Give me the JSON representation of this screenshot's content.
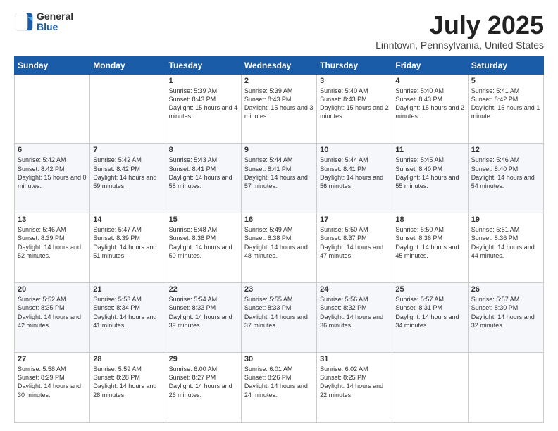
{
  "header": {
    "logo_general": "General",
    "logo_blue": "Blue",
    "month_title": "July 2025",
    "location": "Linntown, Pennsylvania, United States"
  },
  "days_of_week": [
    "Sunday",
    "Monday",
    "Tuesday",
    "Wednesday",
    "Thursday",
    "Friday",
    "Saturday"
  ],
  "weeks": [
    [
      {
        "day": "",
        "sunrise": "",
        "sunset": "",
        "daylight": ""
      },
      {
        "day": "",
        "sunrise": "",
        "sunset": "",
        "daylight": ""
      },
      {
        "day": "1",
        "sunrise": "Sunrise: 5:39 AM",
        "sunset": "Sunset: 8:43 PM",
        "daylight": "Daylight: 15 hours and 4 minutes."
      },
      {
        "day": "2",
        "sunrise": "Sunrise: 5:39 AM",
        "sunset": "Sunset: 8:43 PM",
        "daylight": "Daylight: 15 hours and 3 minutes."
      },
      {
        "day": "3",
        "sunrise": "Sunrise: 5:40 AM",
        "sunset": "Sunset: 8:43 PM",
        "daylight": "Daylight: 15 hours and 2 minutes."
      },
      {
        "day": "4",
        "sunrise": "Sunrise: 5:40 AM",
        "sunset": "Sunset: 8:43 PM",
        "daylight": "Daylight: 15 hours and 2 minutes."
      },
      {
        "day": "5",
        "sunrise": "Sunrise: 5:41 AM",
        "sunset": "Sunset: 8:42 PM",
        "daylight": "Daylight: 15 hours and 1 minute."
      }
    ],
    [
      {
        "day": "6",
        "sunrise": "Sunrise: 5:42 AM",
        "sunset": "Sunset: 8:42 PM",
        "daylight": "Daylight: 15 hours and 0 minutes."
      },
      {
        "day": "7",
        "sunrise": "Sunrise: 5:42 AM",
        "sunset": "Sunset: 8:42 PM",
        "daylight": "Daylight: 14 hours and 59 minutes."
      },
      {
        "day": "8",
        "sunrise": "Sunrise: 5:43 AM",
        "sunset": "Sunset: 8:41 PM",
        "daylight": "Daylight: 14 hours and 58 minutes."
      },
      {
        "day": "9",
        "sunrise": "Sunrise: 5:44 AM",
        "sunset": "Sunset: 8:41 PM",
        "daylight": "Daylight: 14 hours and 57 minutes."
      },
      {
        "day": "10",
        "sunrise": "Sunrise: 5:44 AM",
        "sunset": "Sunset: 8:41 PM",
        "daylight": "Daylight: 14 hours and 56 minutes."
      },
      {
        "day": "11",
        "sunrise": "Sunrise: 5:45 AM",
        "sunset": "Sunset: 8:40 PM",
        "daylight": "Daylight: 14 hours and 55 minutes."
      },
      {
        "day": "12",
        "sunrise": "Sunrise: 5:46 AM",
        "sunset": "Sunset: 8:40 PM",
        "daylight": "Daylight: 14 hours and 54 minutes."
      }
    ],
    [
      {
        "day": "13",
        "sunrise": "Sunrise: 5:46 AM",
        "sunset": "Sunset: 8:39 PM",
        "daylight": "Daylight: 14 hours and 52 minutes."
      },
      {
        "day": "14",
        "sunrise": "Sunrise: 5:47 AM",
        "sunset": "Sunset: 8:39 PM",
        "daylight": "Daylight: 14 hours and 51 minutes."
      },
      {
        "day": "15",
        "sunrise": "Sunrise: 5:48 AM",
        "sunset": "Sunset: 8:38 PM",
        "daylight": "Daylight: 14 hours and 50 minutes."
      },
      {
        "day": "16",
        "sunrise": "Sunrise: 5:49 AM",
        "sunset": "Sunset: 8:38 PM",
        "daylight": "Daylight: 14 hours and 48 minutes."
      },
      {
        "day": "17",
        "sunrise": "Sunrise: 5:50 AM",
        "sunset": "Sunset: 8:37 PM",
        "daylight": "Daylight: 14 hours and 47 minutes."
      },
      {
        "day": "18",
        "sunrise": "Sunrise: 5:50 AM",
        "sunset": "Sunset: 8:36 PM",
        "daylight": "Daylight: 14 hours and 45 minutes."
      },
      {
        "day": "19",
        "sunrise": "Sunrise: 5:51 AM",
        "sunset": "Sunset: 8:36 PM",
        "daylight": "Daylight: 14 hours and 44 minutes."
      }
    ],
    [
      {
        "day": "20",
        "sunrise": "Sunrise: 5:52 AM",
        "sunset": "Sunset: 8:35 PM",
        "daylight": "Daylight: 14 hours and 42 minutes."
      },
      {
        "day": "21",
        "sunrise": "Sunrise: 5:53 AM",
        "sunset": "Sunset: 8:34 PM",
        "daylight": "Daylight: 14 hours and 41 minutes."
      },
      {
        "day": "22",
        "sunrise": "Sunrise: 5:54 AM",
        "sunset": "Sunset: 8:33 PM",
        "daylight": "Daylight: 14 hours and 39 minutes."
      },
      {
        "day": "23",
        "sunrise": "Sunrise: 5:55 AM",
        "sunset": "Sunset: 8:33 PM",
        "daylight": "Daylight: 14 hours and 37 minutes."
      },
      {
        "day": "24",
        "sunrise": "Sunrise: 5:56 AM",
        "sunset": "Sunset: 8:32 PM",
        "daylight": "Daylight: 14 hours and 36 minutes."
      },
      {
        "day": "25",
        "sunrise": "Sunrise: 5:57 AM",
        "sunset": "Sunset: 8:31 PM",
        "daylight": "Daylight: 14 hours and 34 minutes."
      },
      {
        "day": "26",
        "sunrise": "Sunrise: 5:57 AM",
        "sunset": "Sunset: 8:30 PM",
        "daylight": "Daylight: 14 hours and 32 minutes."
      }
    ],
    [
      {
        "day": "27",
        "sunrise": "Sunrise: 5:58 AM",
        "sunset": "Sunset: 8:29 PM",
        "daylight": "Daylight: 14 hours and 30 minutes."
      },
      {
        "day": "28",
        "sunrise": "Sunrise: 5:59 AM",
        "sunset": "Sunset: 8:28 PM",
        "daylight": "Daylight: 14 hours and 28 minutes."
      },
      {
        "day": "29",
        "sunrise": "Sunrise: 6:00 AM",
        "sunset": "Sunset: 8:27 PM",
        "daylight": "Daylight: 14 hours and 26 minutes."
      },
      {
        "day": "30",
        "sunrise": "Sunrise: 6:01 AM",
        "sunset": "Sunset: 8:26 PM",
        "daylight": "Daylight: 14 hours and 24 minutes."
      },
      {
        "day": "31",
        "sunrise": "Sunrise: 6:02 AM",
        "sunset": "Sunset: 8:25 PM",
        "daylight": "Daylight: 14 hours and 22 minutes."
      },
      {
        "day": "",
        "sunrise": "",
        "sunset": "",
        "daylight": ""
      },
      {
        "day": "",
        "sunrise": "",
        "sunset": "",
        "daylight": ""
      }
    ]
  ]
}
